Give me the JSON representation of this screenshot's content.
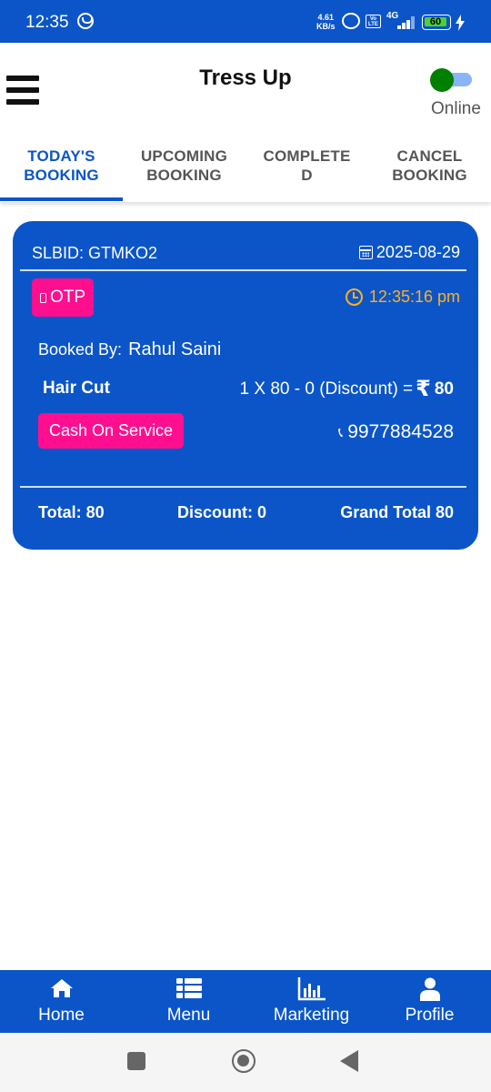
{
  "status_bar": {
    "time": "12:35",
    "speed_value": "4.61",
    "speed_unit": "KB/s",
    "volte": "Vo LTE",
    "network": "4G",
    "battery": "60"
  },
  "header": {
    "title": "Tress Up",
    "online_label": "Online",
    "online_toggle_on": true,
    "toggle_color": "#008000"
  },
  "tabs": [
    {
      "line1": "TODAY'S",
      "line2": "BOOKING",
      "active": true
    },
    {
      "line1": "UPCOMING",
      "line2": "BOOKING",
      "active": false
    },
    {
      "line1": "COMPLETE",
      "line2": "D",
      "active": false
    },
    {
      "line1": "CANCEL",
      "line2": "BOOKING",
      "active": false
    }
  ],
  "booking": {
    "slbid": "SLBID: GTMKO2",
    "date": "2025-08-29",
    "otp_label": "OTP",
    "time": "12:35:16 pm",
    "booked_by_label": "Booked By:",
    "booked_by_name": "Rahul Saini",
    "service_name": "Hair Cut",
    "service_calc": "1 X 80 - 0 (Discount) =",
    "currency": "₹",
    "service_amount": "80",
    "payment_method": "Cash On Service",
    "phone": "9977884528",
    "total": "Total: 80",
    "discount": "Discount: 0",
    "grand_total": "Grand Total 80"
  },
  "bottom_nav": [
    {
      "label": "Home",
      "icon": "home-icon"
    },
    {
      "label": "Menu",
      "icon": "list-icon"
    },
    {
      "label": "Marketing",
      "icon": "bar-chart-icon"
    },
    {
      "label": "Profile",
      "icon": "user-icon"
    }
  ],
  "colors": {
    "primary": "#0b55c9",
    "accent_pink": "#ff0f8f",
    "time_orange": "#ffb020"
  }
}
